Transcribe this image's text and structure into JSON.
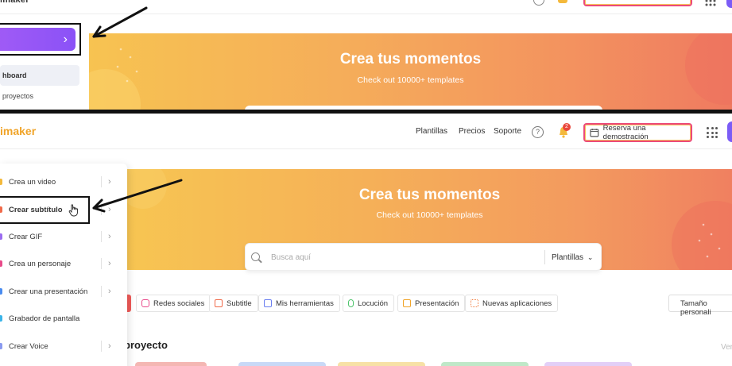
{
  "top": {
    "logo_fragment": "imaker",
    "create_chevron": "›",
    "sidebar": {
      "dashboard": "hboard",
      "projects": "proyectos"
    },
    "banner": {
      "title": "Crea tus momentos",
      "subtitle": "Check out 10000+ templates"
    }
  },
  "header": {
    "logo": "imaker",
    "nav": [
      "Plantillas",
      "Precios",
      "Soporte"
    ],
    "help": "?",
    "notifications_badge": "2",
    "demo_button": "Reserva una demostración"
  },
  "banner": {
    "title": "Crea tus momentos",
    "subtitle": "Check out 10000+ templates",
    "search_placeholder": "Busca aquí",
    "search_select": "Plantillas"
  },
  "categories": [
    {
      "label": "Redes sociales",
      "icon": "instagram-icon",
      "color": "#e84a8a"
    },
    {
      "label": "Subtitle",
      "icon": "subtitle-icon",
      "color": "#f06a4a"
    },
    {
      "label": "Mis herramientas",
      "icon": "tools-icon",
      "color": "#6a7ef0"
    },
    {
      "label": "Locución",
      "icon": "microphone-icon",
      "color": "#4cc46a"
    },
    {
      "label": "Presentación",
      "icon": "presentation-icon",
      "color": "#f0a429"
    },
    {
      "label": "Nuevas aplicaciones",
      "icon": "apps-icon",
      "color": "#f07a3a"
    }
  ],
  "size_button": "Tamaño personali",
  "section": {
    "title": "proyecto",
    "see_all": "Ver"
  },
  "menu": {
    "items": [
      {
        "label": "Crea un video",
        "icon_color": "#f4b93b"
      },
      {
        "label": "Crear subtítulo",
        "icon_color": "#f06a4a",
        "highlighted": true
      },
      {
        "label": "Crear GIF",
        "icon_color": "#9b6cf0"
      },
      {
        "label": "Crea un personaje",
        "icon_color": "#e84a8a"
      },
      {
        "label": "Crear una presentación",
        "icon_color": "#4a8cf0"
      },
      {
        "label": "Grabador de pantalla",
        "icon_color": "#3ab4e8"
      },
      {
        "label": "Crear Voice",
        "icon_color": "#8a9af0"
      }
    ],
    "chevron": "›"
  }
}
